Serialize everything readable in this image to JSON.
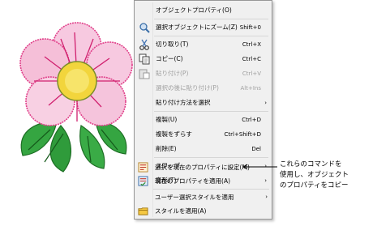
{
  "menu": {
    "items": [
      {
        "label": "オブジェクトプロパティ(O)",
        "shortcut": "",
        "icon": "",
        "submenu": false,
        "disabled": false
      },
      {
        "label": "選択オブジェクトにズーム(Z)",
        "shortcut": "Shift+0",
        "icon": "zoom-object-icon",
        "submenu": false,
        "disabled": false
      },
      {
        "label": "切り取り(T)",
        "shortcut": "Ctrl+X",
        "icon": "scissors-icon",
        "submenu": false,
        "disabled": false
      },
      {
        "label": "コピー(C)",
        "shortcut": "Ctrl+C",
        "icon": "copy-icon",
        "submenu": false,
        "disabled": false
      },
      {
        "label": "貼り付け(P)",
        "shortcut": "Ctrl+V",
        "icon": "paste-icon",
        "submenu": false,
        "disabled": true
      },
      {
        "label": "選択の後に貼り付け(P)",
        "shortcut": "Alt+Ins",
        "icon": "",
        "submenu": false,
        "disabled": true
      },
      {
        "label": "貼り付け方法を選択",
        "shortcut": "",
        "icon": "",
        "submenu": true,
        "disabled": false
      },
      {
        "label": "複製(U)",
        "shortcut": "Ctrl+D",
        "icon": "",
        "submenu": false,
        "disabled": false
      },
      {
        "label": "複製をずらす",
        "shortcut": "Ctrl+Shift+D",
        "icon": "",
        "submenu": false,
        "disabled": false
      },
      {
        "label": "削除(E)",
        "shortcut": "Del",
        "icon": "",
        "submenu": false,
        "disabled": false
      },
      {
        "label": "スワップ",
        "shortcut": "",
        "icon": "",
        "submenu": true,
        "disabled": false
      },
      {
        "label": "変形(T)",
        "shortcut": "",
        "icon": "",
        "submenu": true,
        "disabled": false
      },
      {
        "label": "選択を現在のプロパティに設定(M)",
        "shortcut": "",
        "icon": "set-properties-icon",
        "submenu": false,
        "disabled": false
      },
      {
        "label": "現在のプロパティを適用(A)",
        "shortcut": "",
        "icon": "apply-properties-icon",
        "submenu": false,
        "disabled": false
      },
      {
        "label": "ユーザー選択スタイルを適用",
        "shortcut": "",
        "icon": "",
        "submenu": true,
        "disabled": false
      },
      {
        "label": "スタイルを適用(A)",
        "shortcut": "",
        "icon": "apply-style-icon",
        "submenu": false,
        "disabled": false
      }
    ],
    "submenu_arrow": "›"
  },
  "callout": {
    "lines": [
      "これらのコマンドを",
      "使用し、オブジェクト",
      "のプロパティをコピー"
    ]
  },
  "colors": {
    "menu_bg": "#f0f0f0",
    "highlight": "#d8e6f2",
    "petal": "#f7c9e0",
    "petal_stitch": "#e0408a",
    "center": "#f2d53c",
    "leaf": "#2e9e3a"
  }
}
